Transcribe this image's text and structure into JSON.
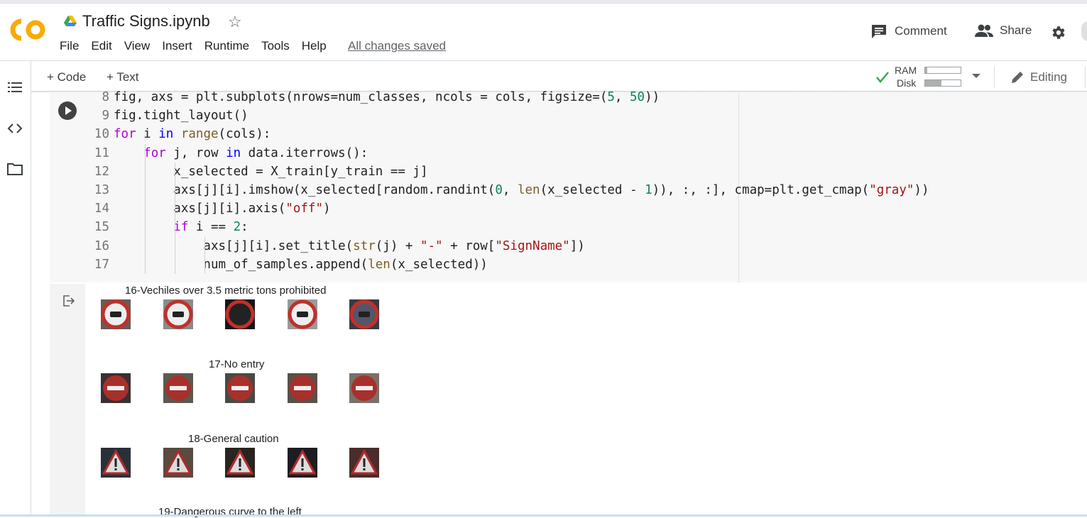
{
  "app": {
    "title": "Traffic Signs.ipynb",
    "logo_text": "CO"
  },
  "menu": [
    "File",
    "Edit",
    "View",
    "Insert",
    "Runtime",
    "Tools",
    "Help"
  ],
  "save_status": "All changes saved",
  "header_actions": {
    "comment": "Comment",
    "share": "Share"
  },
  "toolbar": {
    "add_code": "+ Code",
    "add_text": "+ Text",
    "ram_label": "RAM",
    "disk_label": "Disk",
    "ram_usage": 0.05,
    "disk_usage": 0.45,
    "editing": "Editing"
  },
  "colors": {
    "accent": "#f9ab00",
    "run_button": "#424242",
    "check": "#34a853",
    "keyword": "#af00db",
    "string": "#a31515",
    "number": "#098658"
  },
  "code_lines": [
    {
      "num": "8",
      "text": "fig, axs = plt.subplots(nrows=num_classes, ncols = cols, figsize=(5, 50))"
    },
    {
      "num": "9",
      "text": "fig.tight_layout()"
    },
    {
      "num": "10",
      "text": "for i in range(cols):"
    },
    {
      "num": "11",
      "text": "    for j, row in data.iterrows():"
    },
    {
      "num": "12",
      "text": "        x_selected = X_train[y_train == j]"
    },
    {
      "num": "13",
      "text": "        axs[j][i].imshow(x_selected[random.randint(0, len(x_selected - 1)), :, :], cmap=plt.get_cmap(\"gray\"))"
    },
    {
      "num": "14",
      "text": "        axs[j][i].axis(\"off\")"
    },
    {
      "num": "15",
      "text": "        if i == 2:"
    },
    {
      "num": "16",
      "text": "            axs[j][i].set_title(str(j) + \"-\" + row[\"SignName\"])"
    },
    {
      "num": "17",
      "text": "            num_of_samples.append(len(x_selected))"
    }
  ],
  "output_titles": [
    "16-Vechiles over 3.5 metric tons prohibited",
    "17-No entry",
    "18-General caution",
    "19-Dangerous curve to the left"
  ],
  "icons": [
    "drive-icon",
    "star-icon",
    "comment-icon",
    "share-icon",
    "gear-icon",
    "toc-icon",
    "code-snippets-icon",
    "folder-icon",
    "check-icon",
    "pencil-icon",
    "run-icon",
    "output-icon"
  ]
}
